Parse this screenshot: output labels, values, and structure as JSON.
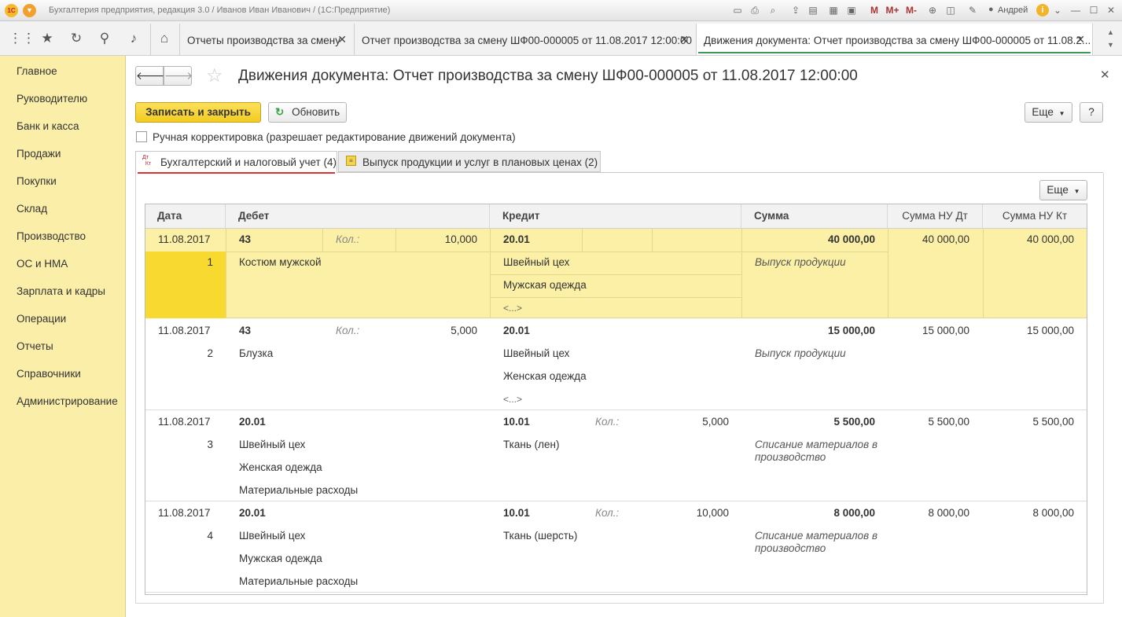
{
  "window": {
    "title": "Бухгалтерия предприятия, редакция 3.0 / Иванов Иван Иванович / (1С:Предприятие)",
    "title_right": "(1С:Предприятие)",
    "logo": "1С",
    "mem_buttons": [
      "M",
      "M+",
      "M-"
    ],
    "user": "Андрей"
  },
  "tabs": [
    {
      "label": "Отчеты производства за смену",
      "active": false
    },
    {
      "label": "Отчет производства за смену ШФ00-000005 от 11.08.2017 12:00:00",
      "active": false
    },
    {
      "label": "Движения документа: Отчет производства за смену ШФ00-000005 от 11.08.2...",
      "active": true
    }
  ],
  "sidebar": {
    "items": [
      "Главное",
      "Руководителю",
      "Банк и касса",
      "Продажи",
      "Покупки",
      "Склад",
      "Производство",
      "ОС и НМА",
      "Зарплата и кадры",
      "Операции",
      "Отчеты",
      "Справочники",
      "Администрирование"
    ]
  },
  "form": {
    "title": "Движения документа: Отчет производства за смену ШФ00-000005 от 11.08.2017 12:00:00",
    "save_close": "Записать и закрыть",
    "refresh": "Обновить",
    "more": "Еще",
    "help": "?",
    "manual_edit_label": "Ручная корректировка (разрешает редактирование движений документа)",
    "manual_edit_checked": false,
    "subtabs": [
      {
        "icon": "Дт Кт",
        "label": "Бухгалтерский и налоговый учет (4)",
        "active": true
      },
      {
        "label": "Выпуск продукции и услуг в плановых ценах (2)",
        "active": false
      }
    ],
    "table_more": "Еще"
  },
  "table": {
    "columns": [
      "Дата",
      "Дебет",
      "Кредит",
      "Сумма",
      "Сумма НУ Дт",
      "Сумма НУ Кт"
    ],
    "rows": [
      {
        "date": "11.08.2017",
        "num": "1",
        "debit_account": "43",
        "debit_qty_label": "Кол.:",
        "debit_qty": "10,000",
        "debit_sub": [
          "Костюм мужской"
        ],
        "credit_account": "20.01",
        "credit_qty_label": "",
        "credit_qty": "",
        "credit_sub": [
          "Швейный цех",
          "Мужская одежда",
          "<...>"
        ],
        "sum": "40 000,00",
        "content": "Выпуск продукции",
        "sum_nu_dt": "40 000,00",
        "sum_nu_kt": "40 000,00",
        "selected": true
      },
      {
        "date": "11.08.2017",
        "num": "2",
        "debit_account": "43",
        "debit_qty_label": "Кол.:",
        "debit_qty": "5,000",
        "debit_sub": [
          "Блузка"
        ],
        "credit_account": "20.01",
        "credit_qty_label": "",
        "credit_qty": "",
        "credit_sub": [
          "Швейный цех",
          "Женская одежда",
          "<...>"
        ],
        "sum": "15 000,00",
        "content": "Выпуск продукции",
        "sum_nu_dt": "15 000,00",
        "sum_nu_kt": "15 000,00",
        "selected": false
      },
      {
        "date": "11.08.2017",
        "num": "3",
        "debit_account": "20.01",
        "debit_qty_label": "",
        "debit_qty": "",
        "debit_sub": [
          "Швейный цех",
          "Женская одежда",
          "Материальные расходы"
        ],
        "credit_account": "10.01",
        "credit_qty_label": "Кол.:",
        "credit_qty": "5,000",
        "credit_sub": [
          "Ткань (лен)"
        ],
        "sum": "5 500,00",
        "content": "Списание материалов в производство",
        "sum_nu_dt": "5 500,00",
        "sum_nu_kt": "5 500,00",
        "selected": false
      },
      {
        "date": "11.08.2017",
        "num": "4",
        "debit_account": "20.01",
        "debit_qty_label": "",
        "debit_qty": "",
        "debit_sub": [
          "Швейный цех",
          "Мужская одежда",
          "Материальные расходы"
        ],
        "credit_account": "10.01",
        "credit_qty_label": "Кол.:",
        "credit_qty": "10,000",
        "credit_sub": [
          "Ткань (шерсть)"
        ],
        "sum": "8 000,00",
        "content": "Списание материалов в производство",
        "sum_nu_dt": "8 000,00",
        "sum_nu_kt": "8 000,00",
        "selected": false
      }
    ]
  },
  "colors": {
    "sidebar_bg": "#fbeea8",
    "selected_row": "#fbf0a6",
    "selected_cell": "#f8d92f",
    "save_button": "#f6d22a",
    "active_tab_line": "#3a9a57",
    "refresh_icon": "#3aa142"
  }
}
